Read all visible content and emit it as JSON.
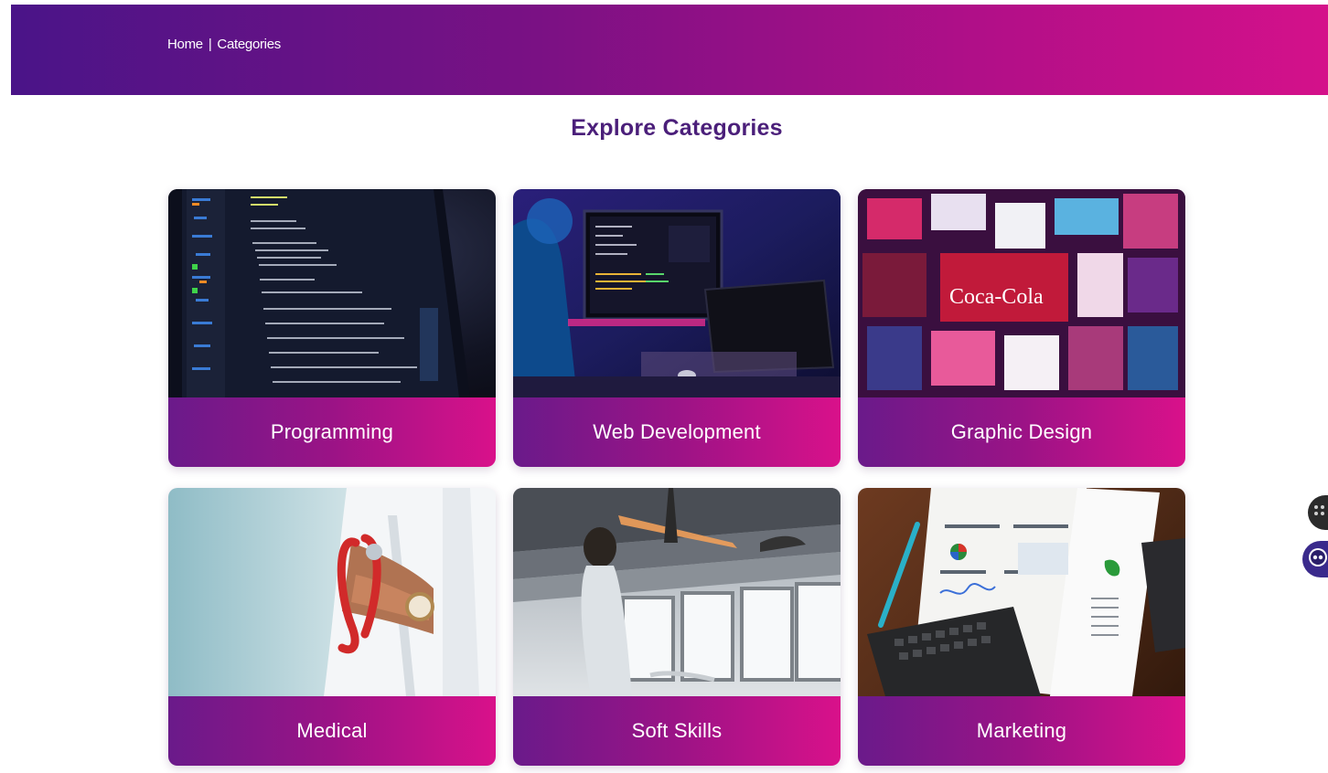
{
  "header": {
    "breadcrumb": {
      "home": "Home",
      "separator": "|",
      "current": "Categories"
    }
  },
  "main": {
    "title": "Explore Categories",
    "categories": [
      {
        "label": "Programming",
        "icon": "code-screen-image"
      },
      {
        "label": "Web Development",
        "icon": "developer-monitor-image"
      },
      {
        "label": "Graphic Design",
        "icon": "design-collage-image"
      },
      {
        "label": "Medical",
        "icon": "doctor-stethoscope-image"
      },
      {
        "label": "Soft Skills",
        "icon": "presenter-office-image"
      },
      {
        "label": "Marketing",
        "icon": "analytics-report-image"
      }
    ]
  },
  "side_widgets": [
    {
      "icon": "grid-dots-icon"
    },
    {
      "icon": "chat-bot-icon"
    }
  ],
  "colors": {
    "banner_start": "#4a1488",
    "banner_end": "#d4118a",
    "title": "#4b1f7a",
    "card_label_start": "#6a1a8a",
    "card_label_end": "#d9118a"
  }
}
